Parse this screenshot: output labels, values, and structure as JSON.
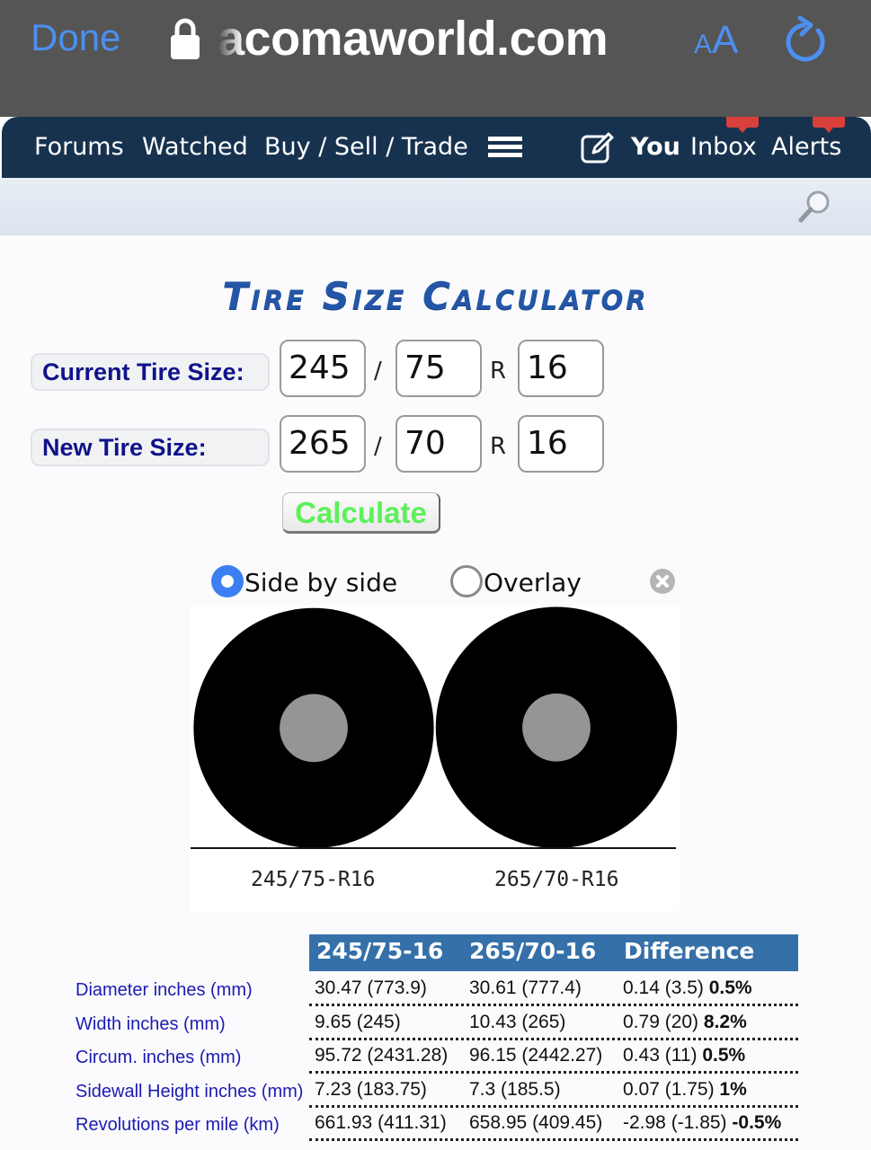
{
  "browser": {
    "done_label": "Done",
    "url": "acomaworld.com",
    "text_size_small": "A",
    "text_size_big": "A",
    "accent_color": "#4d8ff0"
  },
  "nav": {
    "items": [
      "Forums",
      "Watched",
      "Buy / Sell / Trade"
    ],
    "user_items": [
      "You",
      "Inbox",
      "Alerts"
    ],
    "badge_color": "#d9403a"
  },
  "calculator": {
    "title": "Tire Size Calculator",
    "current_label": "Current Tire Size:",
    "new_label": "New Tire Size:",
    "current": {
      "width": "245",
      "ratio": "75",
      "rim": "16"
    },
    "new": {
      "width": "265",
      "ratio": "70",
      "rim": "16"
    },
    "slash": "/",
    "r": "R",
    "calculate_label": "Calculate",
    "view_options": [
      {
        "label": "Side by side",
        "selected": true
      },
      {
        "label": "Overlay",
        "selected": false
      }
    ]
  },
  "diagram": {
    "tires": [
      {
        "label": "245/75-R16",
        "diameter_in": 30.47,
        "rim_in": 16
      },
      {
        "label": "265/70-R16",
        "diameter_in": 30.61,
        "rim_in": 16
      }
    ]
  },
  "results": {
    "headers": [
      "245/75-16",
      "265/70-16",
      "Difference"
    ],
    "rows": [
      {
        "label": "Diameter inches (mm)",
        "current": "30.47 (773.9)",
        "new": "30.61 (777.4)",
        "diff": "0.14 (3.5)",
        "pct": "0.5%"
      },
      {
        "label": "Width inches (mm)",
        "current": "9.65 (245)",
        "new": "10.43 (265)",
        "diff": "0.79 (20)",
        "pct": "8.2%"
      },
      {
        "label": "Circum. inches (mm)",
        "current": "95.72 (2431.28)",
        "new": "96.15 (2442.27)",
        "diff": "0.43 (11)",
        "pct": "0.5%"
      },
      {
        "label": "Sidewall Height inches (mm)",
        "current": "7.23 (183.75)",
        "new": "7.3 (185.5)",
        "diff": "0.07 (1.75)",
        "pct": "1%"
      },
      {
        "label": "Revolutions per mile (km)",
        "current": "661.93 (411.31)",
        "new": "658.95 (409.45)",
        "diff": "-2.98 (-1.85)",
        "pct": "-0.5%"
      }
    ]
  }
}
